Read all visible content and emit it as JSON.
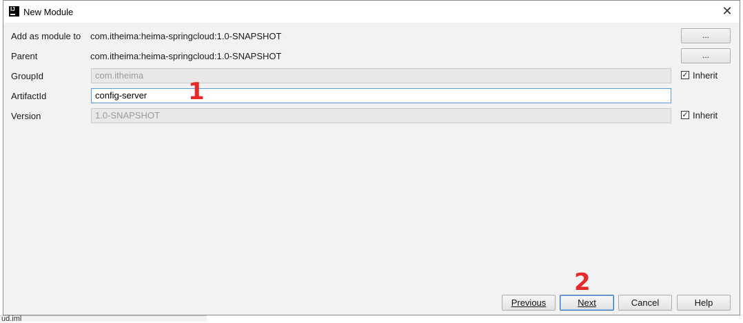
{
  "window": {
    "title": "New Module"
  },
  "form": {
    "add_as_module_label": "Add as module to",
    "add_as_module_value": "com.itheima:heima-springcloud:1.0-SNAPSHOT",
    "parent_label": "Parent",
    "parent_value": "com.itheima:heima-springcloud:1.0-SNAPSHOT",
    "groupid_label": "GroupId",
    "groupid_value": "com.itheima",
    "artifactid_label": "ArtifactId",
    "artifactid_value": "config-server",
    "version_label": "Version",
    "version_value": "1.0-SNAPSHOT",
    "browse_label": "...",
    "inherit_label": "Inherit",
    "groupid_inherit_checked": true,
    "version_inherit_checked": true
  },
  "buttons": {
    "previous": "Previous",
    "next": "Next",
    "cancel": "Cancel",
    "help": "Help"
  },
  "annotations": {
    "step1": "1",
    "step2": "2"
  },
  "background": {
    "bottom_text": "ud.iml"
  },
  "icons": {
    "app": "intellij-icon",
    "close": "close-icon",
    "check": "checkmark-icon"
  },
  "colors": {
    "annotation": "#e52a2a",
    "focus_border": "#5a9be6"
  }
}
